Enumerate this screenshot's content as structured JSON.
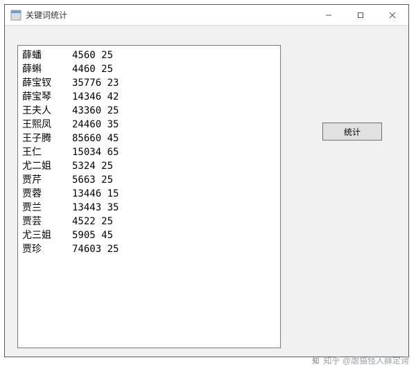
{
  "window": {
    "title": "关键词统计",
    "minimize_tooltip": "Minimize",
    "maximize_tooltip": "Maximize",
    "close_tooltip": "Close"
  },
  "button": {
    "stat_label": "统计"
  },
  "list": {
    "rows": [
      {
        "name": "薛蟠",
        "v1": 4560,
        "v2": 25
      },
      {
        "name": "薛蝌",
        "v1": 4460,
        "v2": 25
      },
      {
        "name": "薛宝钗",
        "v1": 35776,
        "v2": 23
      },
      {
        "name": "薛宝琴",
        "v1": 14346,
        "v2": 42
      },
      {
        "name": "王夫人",
        "v1": 43360,
        "v2": 25
      },
      {
        "name": "王熙凤",
        "v1": 24460,
        "v2": 35
      },
      {
        "name": "王子腾",
        "v1": 85660,
        "v2": 45
      },
      {
        "name": "王仁",
        "v1": 15034,
        "v2": 65
      },
      {
        "name": "尤二姐",
        "v1": 5324,
        "v2": 25
      },
      {
        "name": "贾芹",
        "v1": 5663,
        "v2": 25
      },
      {
        "name": "贾蓉",
        "v1": 13446,
        "v2": 15
      },
      {
        "name": "贾兰",
        "v1": 13443,
        "v2": 35
      },
      {
        "name": "贾芸",
        "v1": 4522,
        "v2": 25
      },
      {
        "name": "尤三姐",
        "v1": 5905,
        "v2": 45
      },
      {
        "name": "贾珍",
        "v1": 74603,
        "v2": 25
      }
    ]
  },
  "watermark": {
    "text": "知乎 @虐猫怪人薛定谔"
  }
}
